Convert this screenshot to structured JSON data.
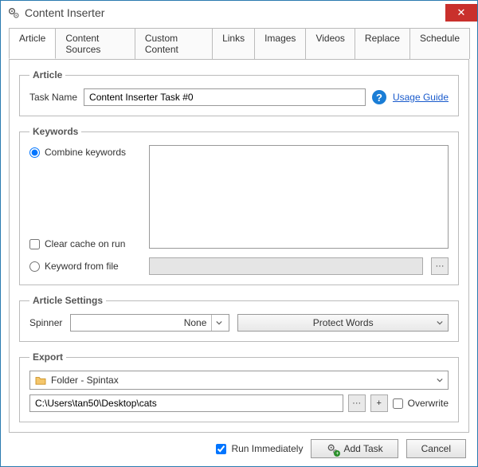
{
  "window": {
    "title": "Content Inserter"
  },
  "tabs": [
    "Article",
    "Content Sources",
    "Custom Content",
    "Links",
    "Images",
    "Videos",
    "Replace",
    "Schedule"
  ],
  "article": {
    "legend": "Article",
    "task_name_label": "Task Name",
    "task_name_value": "Content Inserter Task #0",
    "usage_guide": "Usage Guide"
  },
  "keywords": {
    "legend": "Keywords",
    "combine_label": "Combine keywords",
    "clear_cache_label": "Clear cache on run",
    "from_file_label": "Keyword from file"
  },
  "settings": {
    "legend": "Article Settings",
    "spinner_label": "Spinner",
    "spinner_value": "None",
    "protect_words": "Protect Words"
  },
  "export": {
    "legend": "Export",
    "select_value": "Folder - Spintax",
    "path_value": "C:\\Users\\tan50\\Desktop\\cats",
    "overwrite_label": "Overwrite"
  },
  "footer": {
    "run_immediately": "Run Immediately",
    "add_task": "Add Task",
    "cancel": "Cancel"
  },
  "glyphs": {
    "ellipsis": "···",
    "help": "?",
    "close": "✕"
  }
}
